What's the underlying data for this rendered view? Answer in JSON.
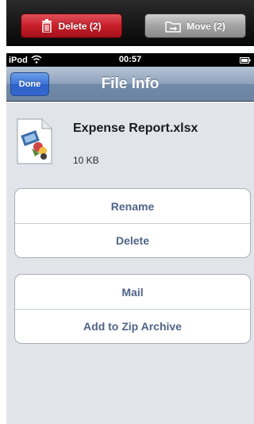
{
  "toolbar": {
    "delete_label": "Delete (2)",
    "move_label": "Move (2)"
  },
  "status_bar": {
    "carrier": "iPod",
    "time": "00:57"
  },
  "nav": {
    "title": "File Info",
    "done_label": "Done"
  },
  "file": {
    "name": "Expense Report.xlsx",
    "size": "10 KB"
  },
  "actions_group_1": [
    {
      "label": "Rename"
    },
    {
      "label": "Delete"
    }
  ],
  "actions_group_2": [
    {
      "label": "Mail"
    },
    {
      "label": "Add to Zip Archive"
    }
  ],
  "colors": {
    "delete_button": "#c81f2a",
    "move_button": "#a3a3a3",
    "nav_bar": "#8ea2bc",
    "done_button": "#3d74d8",
    "row_text": "#4f6487",
    "content_background": "#e1e5ea"
  }
}
